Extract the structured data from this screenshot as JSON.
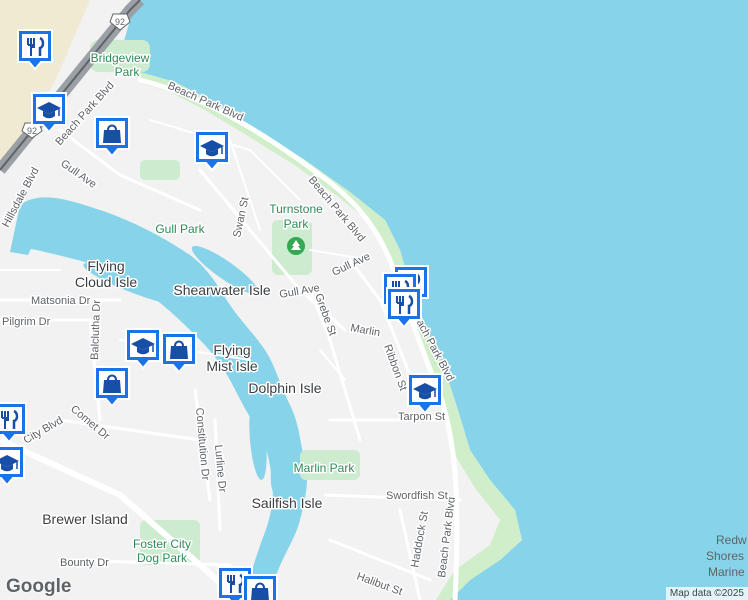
{
  "highway": "92",
  "roads": {
    "beach_park_blvd": "Beach Park Blvd",
    "hillsdale_blvd": "Hillsdale Blvd",
    "gull_ave": "Gull Ave",
    "swan_st": "Swan St",
    "matsonia_dr": "Matsonia Dr",
    "pilgrim_dr": "Pilgrim Dr",
    "balclutha_dr": "Balclutha Dr",
    "grebe_st": "Grebe St",
    "marlin": "Marlin",
    "ribbon_st": "Ribbon St",
    "tarpon_st": "Tarpon St",
    "constitution_dr": "Constitution Dr",
    "lurline_dr": "Lurline Dr",
    "comet_dr": "Comet Dr",
    "city_blvd": "City Blvd",
    "swordfish_st": "Swordfish St",
    "haddock_st": "Haddock St",
    "halibut_st": "Halibut St",
    "bounty_dr": "Bounty Dr"
  },
  "places": {
    "bridgeview_park_1": "Bridgeview",
    "bridgeview_park_2": "Park",
    "turnstone_park_1": "Turnstone",
    "turnstone_park_2": "Park",
    "gull_park": "Gull Park",
    "flying_cloud_1": "Flying",
    "flying_cloud_2": "Cloud Isle",
    "shearwater_isle": "Shearwater Isle",
    "flying_mist_1": "Flying",
    "flying_mist_2": "Mist Isle",
    "dolphin_isle": "Dolphin Isle",
    "marlin_park": "Marlin Park",
    "sailfish_isle": "Sailfish Isle",
    "brewer_island": "Brewer Island",
    "foster_city_dog_park_1": "Foster City",
    "foster_city_dog_park_2": "Dog Park",
    "redwood_shores_1": "Redw",
    "redwood_shores_2": "Shores",
    "redwood_shores_3": "Marine"
  },
  "logo": "Google",
  "attribution": "Map data ©2025",
  "colors": {
    "water": "#87d4ea",
    "land": "#f2f2f2",
    "park": "#cdeccf",
    "beach": "#cfeec9",
    "pin": "#1a73e8"
  },
  "icons": {
    "restaurant": "fork-knife-icon",
    "school": "graduation-cap-icon",
    "shopping": "shopping-bag-icon",
    "park": "tree-icon"
  }
}
